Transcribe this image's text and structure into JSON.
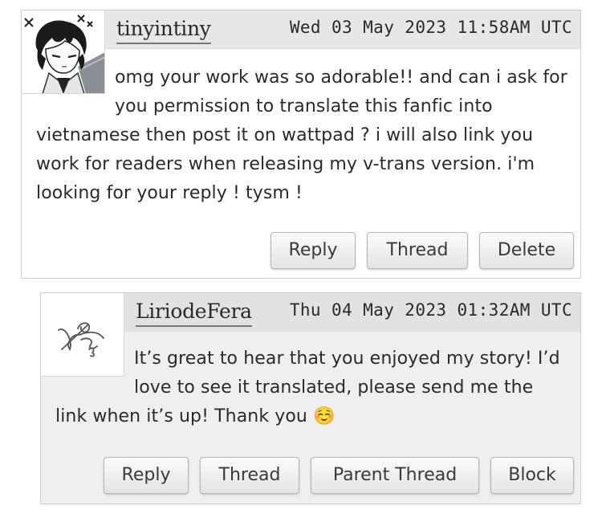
{
  "comments": [
    {
      "username": "tinyintiny",
      "datetime": "Wed 03 May 2023 11:58AM UTC",
      "avatar_icon": "anime-character-avatar",
      "text": "omg your work was so adorable!! and can i ask for you permission to translate this fanfic into vietnamese then post it on wattpad ? i will also link you work for readers when releasing my v-trans version. i'm looking for your reply ! tysm !",
      "buttons": {
        "reply": "Reply",
        "thread": "Thread",
        "delete": "Delete"
      }
    },
    {
      "username": "LiriodeFera",
      "datetime": "Thu 04 May 2023 01:32AM UTC",
      "avatar_icon": "sketch-signature-avatar",
      "text": "It’s great to hear that you enjoyed my story! I’d love to see it translated, please send me the link when it’s up! Thank you ☺️",
      "buttons": {
        "reply": "Reply",
        "thread": "Thread",
        "parent_thread": "Parent Thread",
        "block": "Block"
      }
    }
  ]
}
